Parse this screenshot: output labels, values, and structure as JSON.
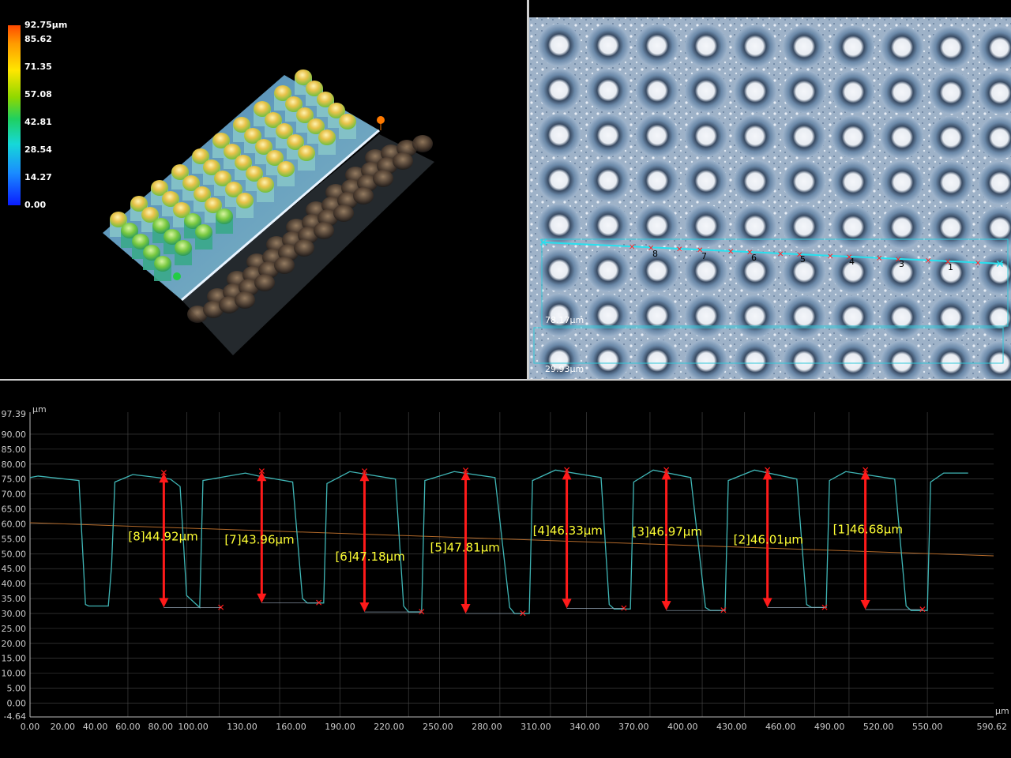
{
  "colorbar": {
    "max_label": "92.75µm",
    "labels": [
      "85.62",
      "71.35",
      "57.08",
      "42.81",
      "28.54",
      "14.27",
      "0.00"
    ]
  },
  "micrograph": {
    "point_labels": [
      "8",
      "7",
      "6",
      "5",
      "4",
      "3",
      "1"
    ],
    "dim_label_1": "78.17µm",
    "dim_label_2": "29.93µm"
  },
  "profile": {
    "y_unit": "µm",
    "x_unit": "µm",
    "y_min_label": "-4.64",
    "y_max_label": "97.39",
    "y_ticks": [
      "90.00",
      "85.00",
      "80.00",
      "75.00",
      "70.00",
      "65.00",
      "60.00",
      "55.00",
      "50.00",
      "45.00",
      "40.00",
      "35.00",
      "30.00",
      "25.00",
      "20.00",
      "15.00",
      "10.00",
      "5.00",
      "0.00"
    ],
    "x_ticks": [
      "0.00",
      "20.00",
      "40.00",
      "60.00",
      "80.00",
      "100.00",
      "130.00",
      "160.00",
      "190.00",
      "220.00",
      "250.00",
      "280.00",
      "310.00",
      "340.00",
      "370.00",
      "400.00",
      "430.00",
      "460.00",
      "490.00",
      "520.00",
      "550.00"
    ],
    "x_max_label": "590.62",
    "measurements": [
      "[8]44.92µm",
      "[7]43.96µm",
      "[6]47.18µm",
      "[5]47.81µm",
      "[4]46.33µm",
      "[3]46.97µm",
      "[2]46.01µm",
      "[1]46.68µm"
    ]
  },
  "chart_data": {
    "type": "line",
    "xlabel": "µm",
    "ylabel": "µm",
    "xlim": [
      0,
      590.62
    ],
    "ylim": [
      -4.64,
      97.39
    ],
    "grid": true,
    "series": [
      {
        "x": [
          0,
          5,
          30,
          34,
          36,
          48,
          50,
          52,
          63,
          86,
          92,
          96,
          104,
          106,
          132,
          140,
          161,
          167,
          170,
          180,
          182,
          196,
          224,
          229,
          232,
          240,
          242,
          260,
          285,
          294,
          297,
          306,
          308,
          322,
          350,
          355,
          358,
          368,
          370,
          382,
          405,
          414,
          417,
          426,
          428,
          444,
          470,
          476,
          479,
          488,
          490,
          500,
          530,
          537,
          540,
          550,
          552,
          560,
          575
        ],
        "y": [
          75.5,
          76,
          74.5,
          33,
          32.5,
          32.5,
          46,
          74,
          76.5,
          75,
          72.5,
          36,
          32,
          74.5,
          77,
          76,
          74,
          35,
          33.5,
          33.5,
          73.5,
          77.5,
          75,
          32.5,
          30.5,
          30.5,
          74.5,
          77.5,
          75.5,
          32,
          30,
          30,
          74.5,
          78,
          75.5,
          33,
          31.5,
          31.5,
          74,
          78,
          75.5,
          32,
          31,
          31,
          74.5,
          78,
          75,
          33,
          32,
          32,
          74.5,
          77.5,
          75,
          32.5,
          31,
          31,
          74,
          77,
          77
        ]
      }
    ],
    "measurements": [
      {
        "label": "[8]44.92µm",
        "x": 82,
        "y_top": 77,
        "y_bottom": 32
      },
      {
        "label": "[7]43.96µm",
        "x": 142,
        "y_top": 77.5,
        "y_bottom": 33.5
      },
      {
        "label": "[6]47.18µm",
        "x": 205,
        "y_top": 77.5,
        "y_bottom": 30.5
      },
      {
        "label": "[5]47.81µm",
        "x": 267,
        "y_top": 77.8,
        "y_bottom": 30
      },
      {
        "label": "[4]46.33µm",
        "x": 329,
        "y_top": 78,
        "y_bottom": 31.7
      },
      {
        "label": "[3]46.97µm",
        "x": 390,
        "y_top": 78,
        "y_bottom": 31
      },
      {
        "label": "[2]46.01µm",
        "x": 452,
        "y_top": 78,
        "y_bottom": 32
      },
      {
        "label": "[1]46.68µm",
        "x": 512,
        "y_top": 78,
        "y_bottom": 31.3
      }
    ],
    "colors": {
      "profile": "#3fb6b6",
      "arrow": "#ff1a1a",
      "label": "#ffff33",
      "ref_line": "#b36a2a"
    }
  }
}
